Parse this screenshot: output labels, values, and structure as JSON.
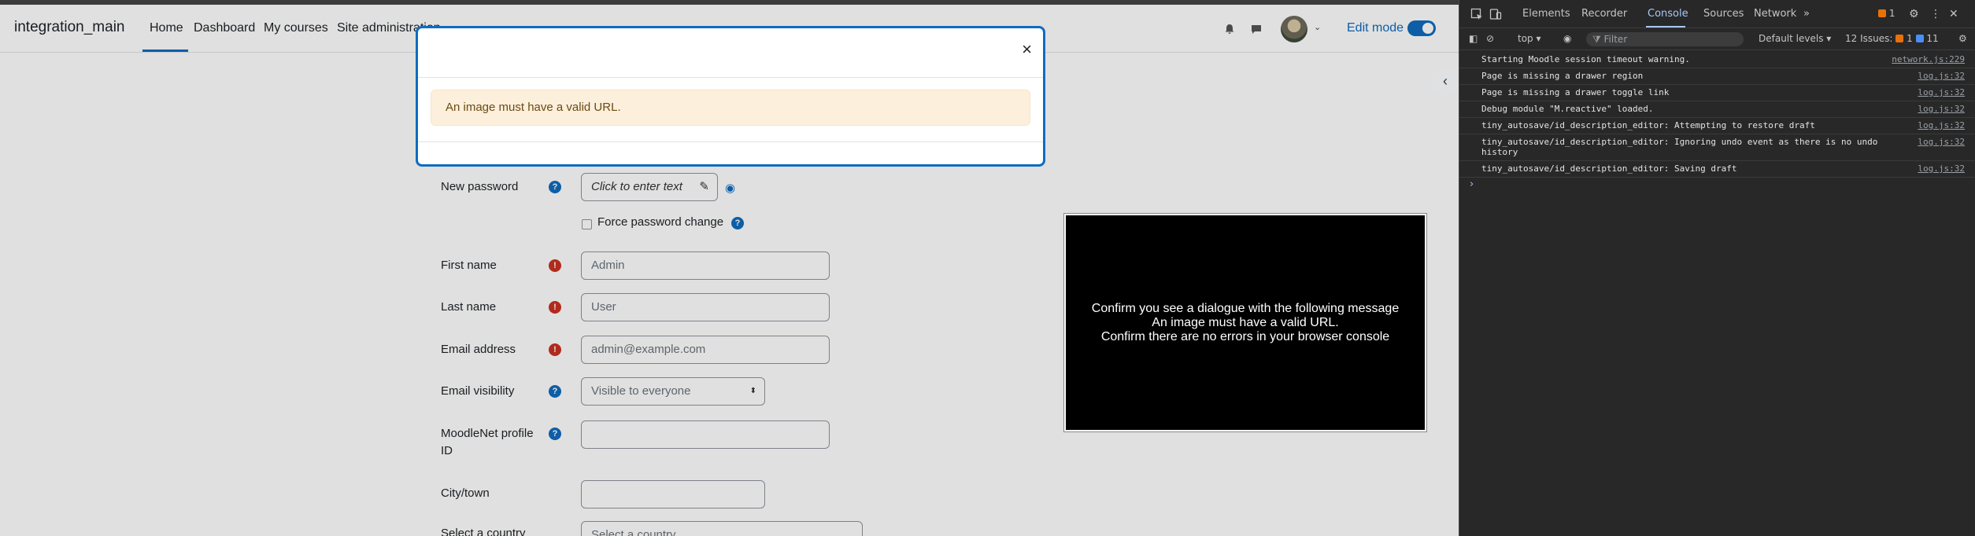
{
  "navbar": {
    "brand": "integration_main",
    "items": [
      "Home",
      "Dashboard",
      "My courses",
      "Site administration"
    ],
    "edit_mode_label": "Edit mode"
  },
  "modal": {
    "close_glyph": "×",
    "alert_text": "An image must have a valid URL."
  },
  "form": {
    "new_password_label": "New password",
    "password_placeholder": "Click to enter text",
    "force_password_label": "Force password change",
    "first_name_label": "First name",
    "first_name_value": "Admin",
    "last_name_label": "Last name",
    "last_name_value": "User",
    "email_label": "Email address",
    "email_value": "admin@example.com",
    "email_visibility_label": "Email visibility",
    "email_visibility_value": "Visible to everyone",
    "moodlenet_label_1": "MoodleNet profile",
    "moodlenet_label_2": "ID",
    "city_label": "City/town",
    "country_label": "Select a country",
    "country_value": "Select a country"
  },
  "instructions": {
    "line1": "Confirm you see a dialogue with the following message",
    "line2": "An image must have a valid URL.",
    "line3": "Confirm there are no errors in your browser console"
  },
  "devtools": {
    "tabs": [
      "Elements",
      "Recorder",
      "Console",
      "Sources",
      "Network"
    ],
    "active_tab": "Console",
    "more_tabs": "»",
    "warning_count": "1",
    "context": "top",
    "filter_placeholder": "Filter",
    "levels": "Default levels",
    "issues_label": "12 Issues:",
    "issues_warn": "1",
    "issues_info": "11",
    "logs": [
      {
        "msg": "Starting Moodle session timeout warning.",
        "src": "network.js:229"
      },
      {
        "msg": "Page is missing a drawer region",
        "src": "log.js:32"
      },
      {
        "msg": "Page is missing a drawer toggle link",
        "src": "log.js:32"
      },
      {
        "msg": "Debug module \"M.reactive\" loaded.",
        "src": "log.js:32"
      },
      {
        "msg": "tiny_autosave/id_description_editor: Attempting to restore draft",
        "src": "log.js:32"
      },
      {
        "msg": "tiny_autosave/id_description_editor: Ignoring undo event as there is no undo history",
        "src": "log.js:32"
      },
      {
        "msg": "tiny_autosave/id_description_editor: Saving draft",
        "src": "log.js:32"
      }
    ],
    "prompt_glyph": "›"
  },
  "colors": {
    "accent": "#0f6cbf",
    "required": "#ca3120",
    "alert_bg": "#fcefdc",
    "devtools_bg": "#282828"
  }
}
